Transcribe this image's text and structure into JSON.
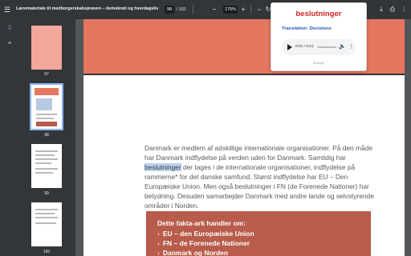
{
  "toolbar": {
    "title": "Læremateriale til medborgerskabsprøven – demokrati og hverdagsliv i Danmark",
    "page_current": "98",
    "page_total": "/ 161",
    "zoom": "175%",
    "icons": [
      "menu-icon",
      "zoom-out-icon",
      "zoom-in-icon",
      "fit-page-icon",
      "rotate-icon",
      "download-icon",
      "print-icon",
      "more-icon"
    ]
  },
  "sidebar": {
    "icons": [
      "thumbnails-icon",
      "outline-icon"
    ]
  },
  "thumbnails": [
    {
      "number": "97",
      "color": "#f2a79a"
    },
    {
      "number": "98",
      "color": "#ffffff"
    },
    {
      "number": "99",
      "color": "#ffffff"
    },
    {
      "number": "100",
      "color": "#ffffff"
    }
  ],
  "page": {
    "band_color": "#e6765f",
    "text_before": "Danmark er medlem af adskillige internationale organisationer. På den måde har Danmark indflydelse på verden uden for Danmark. Samtidig har ",
    "highlight": "beslutninger",
    "text_after": " der tages i de internationale organisationer, indflydelse på rammerne* for det danske samfund. Størst indflydelse har EU – Den Europæiske Union. Men også beslutninger i FN (de Forenede Nationer) har betydning. Desuden samarbejder Danmark med andre lande og selvstyrende områder i Norden.",
    "fact_title": "Dette fakta-ark handler om:",
    "fact_items": [
      "EU – den Europæiske Union",
      "FN – de Forenede Nationer",
      "Danmark og Norden"
    ]
  },
  "popup": {
    "word": "beslutninger",
    "translation": "Translation: Decisions",
    "audio_time": "0:01 / 0:01",
    "footer": "Settings"
  }
}
